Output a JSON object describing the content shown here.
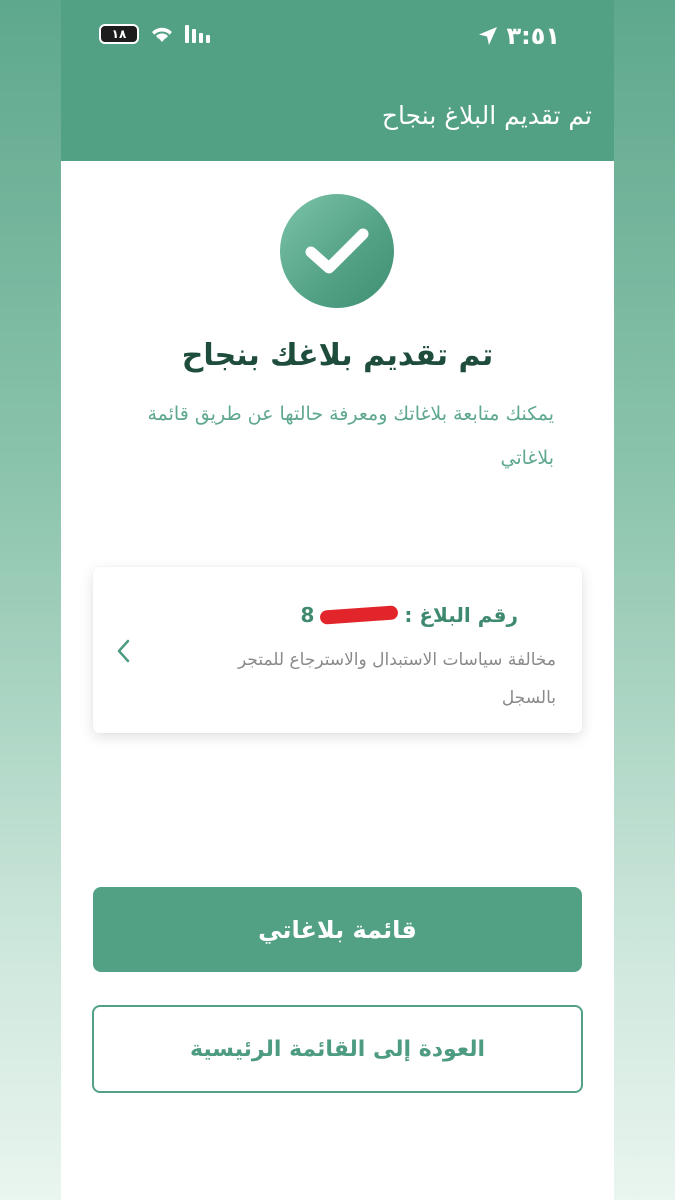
{
  "status_bar": {
    "time": "٣:٥١",
    "battery": "١٨"
  },
  "app_bar": {
    "title": "تم تقديم البلاغ بنجاح"
  },
  "success": {
    "headline": "تم تقديم بلاغك بنجاح",
    "message": "يمكنك متابعة بلاغاتك ومعرفة حالتها عن طريق قائمة بلاغاتي"
  },
  "report_card": {
    "number_label": "رقم البلاغ :",
    "number_visible": "8",
    "description": "مخالفة سياسات الاستبدال والاسترجاع للمتجر بالسجل"
  },
  "buttons": {
    "my_reports": "قائمة بلاغاتي",
    "back_home": "العودة إلى القائمة الرئيسية"
  },
  "colors": {
    "primary": "#52a185",
    "heading": "#1f4d3c",
    "redaction": "#e2252b"
  }
}
